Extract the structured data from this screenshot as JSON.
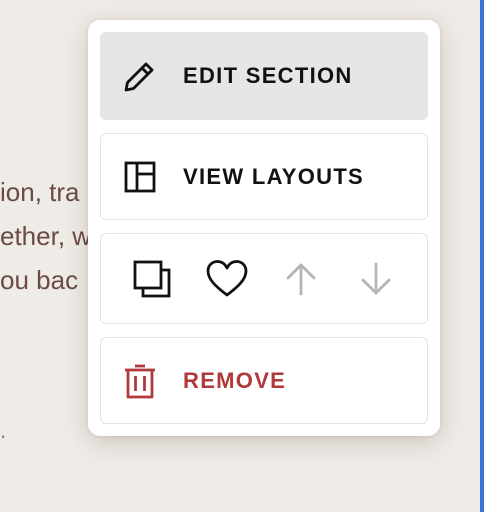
{
  "background": {
    "text_lines": [
      "ion, tra",
      "ether, w",
      "ou bac"
    ],
    "mark": "."
  },
  "menu": {
    "edit_label": "EDIT SECTION",
    "layouts_label": "VIEW LAYOUTS",
    "remove_label": "REMOVE",
    "actions": [
      {
        "name": "duplicate",
        "icon": "duplicate-icon",
        "enabled": true
      },
      {
        "name": "favorite",
        "icon": "heart-icon",
        "enabled": true
      },
      {
        "name": "move-up",
        "icon": "arrow-up-icon",
        "enabled": false
      },
      {
        "name": "move-down",
        "icon": "arrow-down-icon",
        "enabled": false
      }
    ]
  },
  "colors": {
    "page_background": "#efebe6",
    "background_text": "#6b4a4a",
    "menu_background": "#ffffff",
    "active_item": "#e6e6e6",
    "remove_accent": "#b03a3a",
    "disabled_icon": "#b5b5b5",
    "edge_accent": "#3b74d6"
  }
}
